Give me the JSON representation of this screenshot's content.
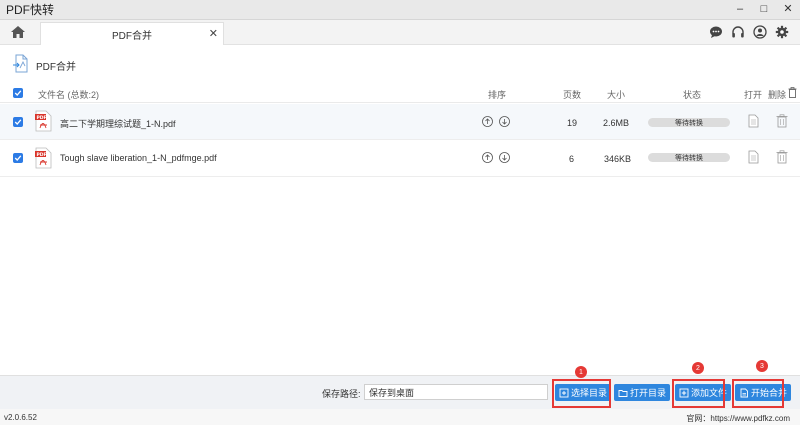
{
  "app": {
    "title": "PDF快转"
  },
  "window_controls": {
    "minimize": "–",
    "maximize": "□",
    "close": "✕"
  },
  "tabs": [
    {
      "label": "PDF合并",
      "close": "✕"
    }
  ],
  "page": {
    "title": "PDF合并"
  },
  "table": {
    "headers": {
      "filename": "文件名 (总数:2)",
      "sort": "排序",
      "pages": "页数",
      "size": "大小",
      "status": "状态",
      "open": "打开",
      "delete": "删除"
    },
    "rows": [
      {
        "name": "高二下学期理综试题_1-N.pdf",
        "pages": "19",
        "size": "2.6MB",
        "status": "等待转换"
      },
      {
        "name": "Tough slave liberation_1-N_pdfmge.pdf",
        "pages": "6",
        "size": "346KB",
        "status": "等待转换"
      }
    ]
  },
  "bottombar": {
    "save_label": "保存路径:",
    "save_value": "保存到桌面",
    "buttons": {
      "select_dir": "选择目录",
      "open_dir": "打开目录",
      "add_file": "添加文件",
      "start_merge": "开始合并"
    },
    "badges": [
      "1",
      "2",
      "3"
    ]
  },
  "statusbar": {
    "version": "v2.0.6.52",
    "website": "官网：https://www.pdfkz.com"
  },
  "colors": {
    "accent": "#2e86de",
    "checkbox": "#2c7be5",
    "highlight": "#e53935",
    "pdf_icon": "#d9352b"
  }
}
